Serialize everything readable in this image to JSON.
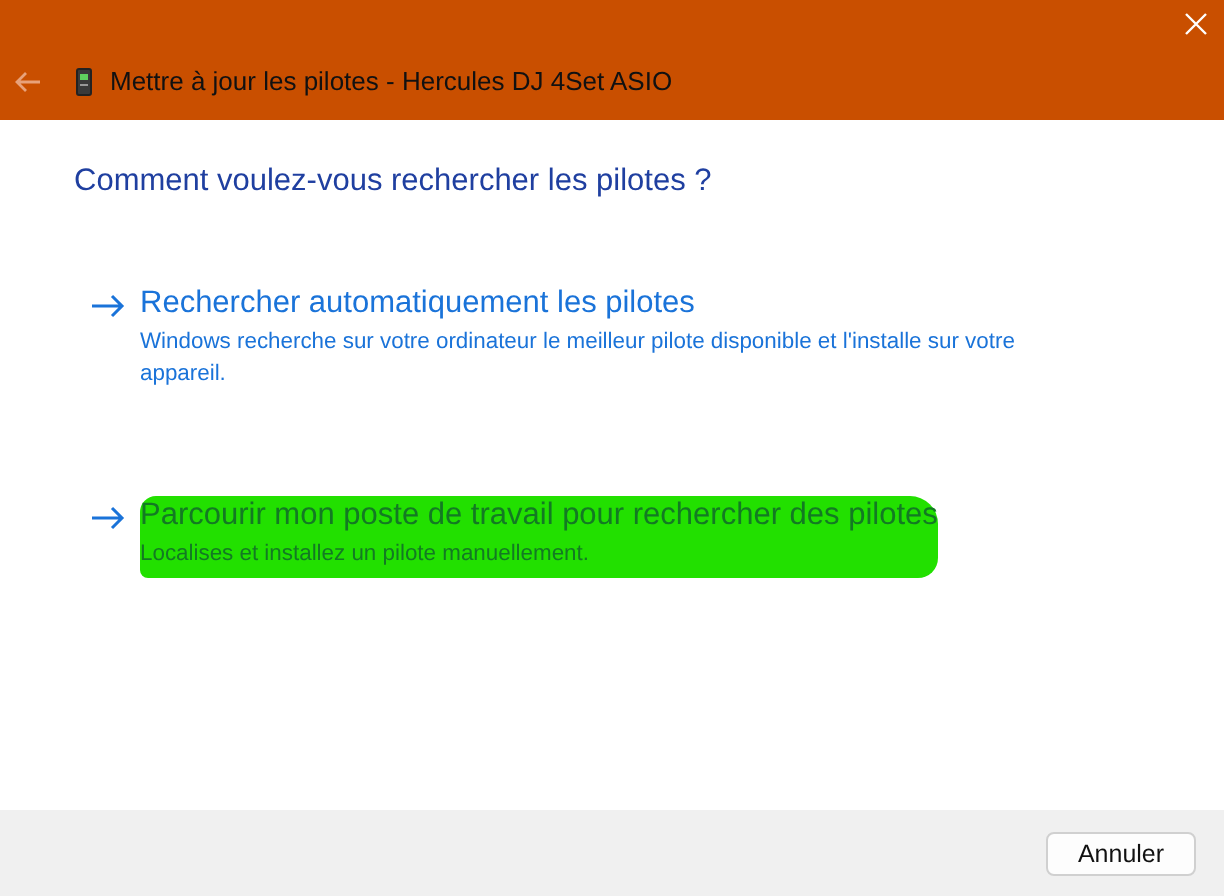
{
  "window": {
    "title": "Mettre à jour les pilotes - Hercules DJ 4Set ASIO"
  },
  "heading": "Comment voulez-vous rechercher les pilotes ?",
  "options": [
    {
      "title": "Rechercher automatiquement les pilotes",
      "description": "Windows recherche sur votre ordinateur le meilleur pilote disponible et l'installe sur votre appareil.",
      "highlighted": false
    },
    {
      "title": "Parcourir mon poste de travail pour rechercher des pilotes",
      "description": "Localises et installez un pilote manuellement.",
      "highlighted": true
    }
  ],
  "buttons": [
    "Annuler"
  ]
}
